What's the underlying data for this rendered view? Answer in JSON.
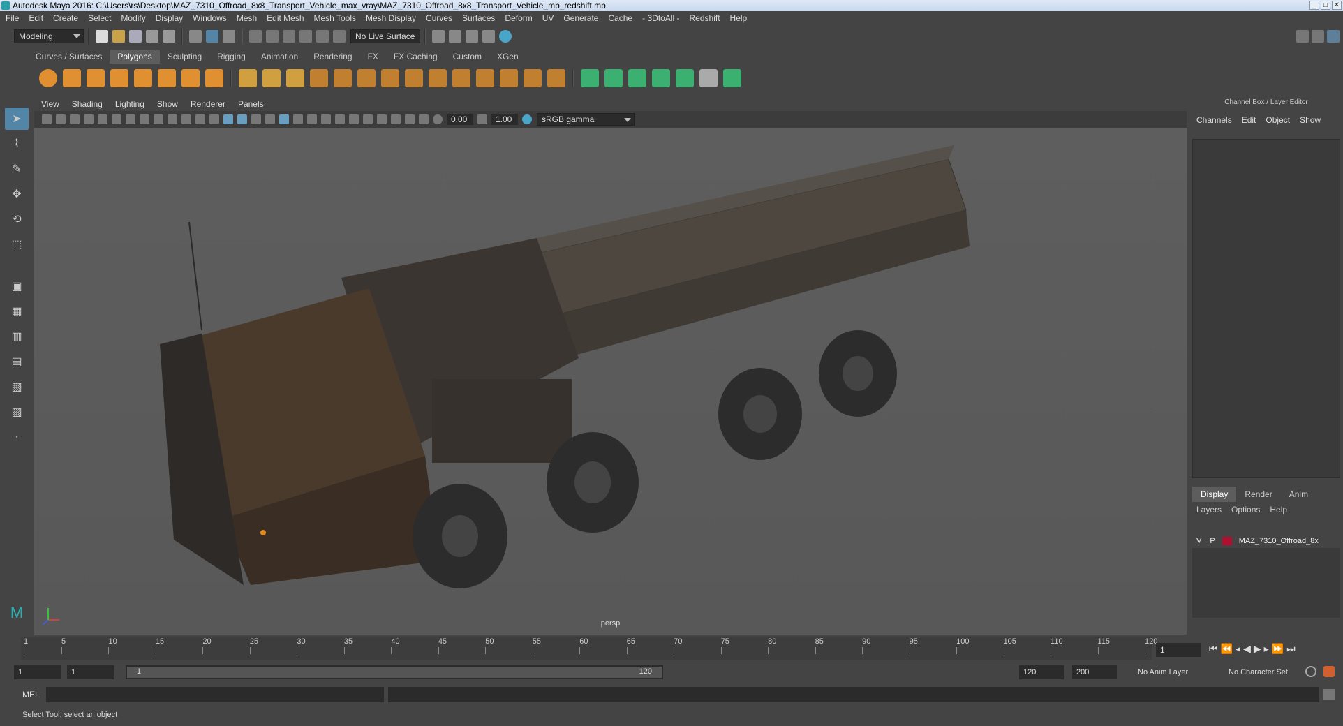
{
  "window": {
    "title": "Autodesk Maya 2016: C:\\Users\\rs\\Desktop\\MAZ_7310_Offroad_8x8_Transport_Vehicle_max_vray\\MAZ_7310_Offroad_8x8_Transport_Vehicle_mb_redshift.mb"
  },
  "menubar": [
    "File",
    "Edit",
    "Create",
    "Select",
    "Modify",
    "Display",
    "Windows",
    "Mesh",
    "Edit Mesh",
    "Mesh Tools",
    "Mesh Display",
    "Curves",
    "Surfaces",
    "Deform",
    "UV",
    "Generate",
    "Cache",
    "- 3DtoAll -",
    "Redshift",
    "Help"
  ],
  "status": {
    "mode": "Modeling",
    "live_surface": "No Live Surface"
  },
  "shelf_tabs": [
    "Curves / Surfaces",
    "Polygons",
    "Sculpting",
    "Rigging",
    "Animation",
    "Rendering",
    "FX",
    "FX Caching",
    "Custom",
    "XGen"
  ],
  "active_shelf": "Polygons",
  "viewport_menu": [
    "View",
    "Shading",
    "Lighting",
    "Show",
    "Renderer",
    "Panels"
  ],
  "viewport_toolbar": {
    "exposure": "0.00",
    "gamma": "1.00",
    "color_space": "sRGB gamma"
  },
  "viewport": {
    "camera": "persp"
  },
  "channel_box": {
    "title": "Channel Box / Layer Editor",
    "menu": [
      "Channels",
      "Edit",
      "Object",
      "Show"
    ]
  },
  "layer_editor": {
    "tabs": [
      "Display",
      "Render",
      "Anim"
    ],
    "active_tab": "Display",
    "menu": [
      "Layers",
      "Options",
      "Help"
    ],
    "layer": {
      "visible": "V",
      "playback": "P",
      "name": "MAZ_7310_Offroad_8x",
      "color": "#b01030"
    }
  },
  "timeline": {
    "ticks": [
      "1",
      "5",
      "10",
      "15",
      "20",
      "25",
      "30",
      "35",
      "40",
      "45",
      "50",
      "55",
      "60",
      "65",
      "70",
      "75",
      "80",
      "85",
      "90",
      "95",
      "100",
      "105",
      "110",
      "115",
      "120"
    ],
    "current_frame": "1"
  },
  "range": {
    "start": "1",
    "range_start": "1",
    "slider_start": "1",
    "slider_end": "120",
    "end": "120",
    "anim_end": "200",
    "anim_layer": "No Anim Layer",
    "character_set": "No Character Set"
  },
  "command_line": {
    "label": "MEL"
  },
  "help_line": "Select Tool: select an object"
}
